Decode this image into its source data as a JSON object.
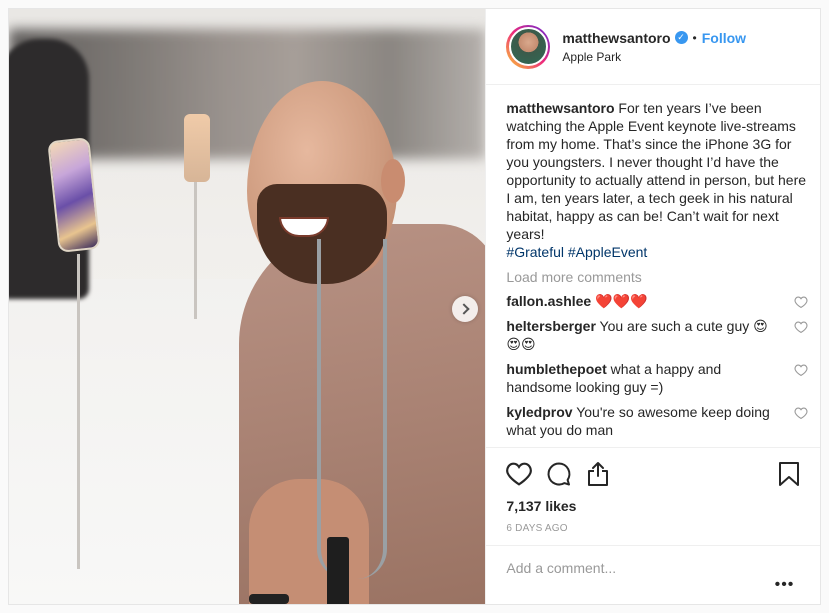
{
  "post": {
    "user": {
      "username": "matthewsantoro",
      "location": "Apple Park",
      "follow_label": "Follow",
      "verified": true
    },
    "caption": {
      "username": "matthewsantoro",
      "text": "For ten years I’ve been watching the Apple Event keynote live-streams from my home. That’s since the iPhone 3G for you youngsters. I never thought I’d have the opportunity to actually attend in person, but here I am, ten years later, a tech geek in his natural habitat, happy as can be! Can’t wait for next years!",
      "hashtags": [
        "#Grateful",
        "#AppleEvent"
      ]
    },
    "load_more_label": "Load more comments",
    "comments": [
      {
        "username": "fallon.ashlee",
        "text": "❤️❤️❤️"
      },
      {
        "username": "heltersberger",
        "text": "You are such a cute guy 😍😍😍"
      },
      {
        "username": "humblethepoet",
        "text": "what a happy and handsome looking guy =)"
      },
      {
        "username": "kyledprov",
        "text": "You're so awesome keep doing what you do man"
      }
    ],
    "likes": "7,137 likes",
    "timestamp": "6 DAYS AGO",
    "add_comment_placeholder": "Add a comment...",
    "more_options": "•••"
  },
  "icons": {
    "like": "heart-icon",
    "comment": "comment-icon",
    "share": "share-icon",
    "save": "bookmark-icon",
    "next": "chevron-right-icon"
  },
  "colors": {
    "link": "#3897f0",
    "hashtag": "#003569",
    "muted": "#999999",
    "text": "#262626"
  }
}
